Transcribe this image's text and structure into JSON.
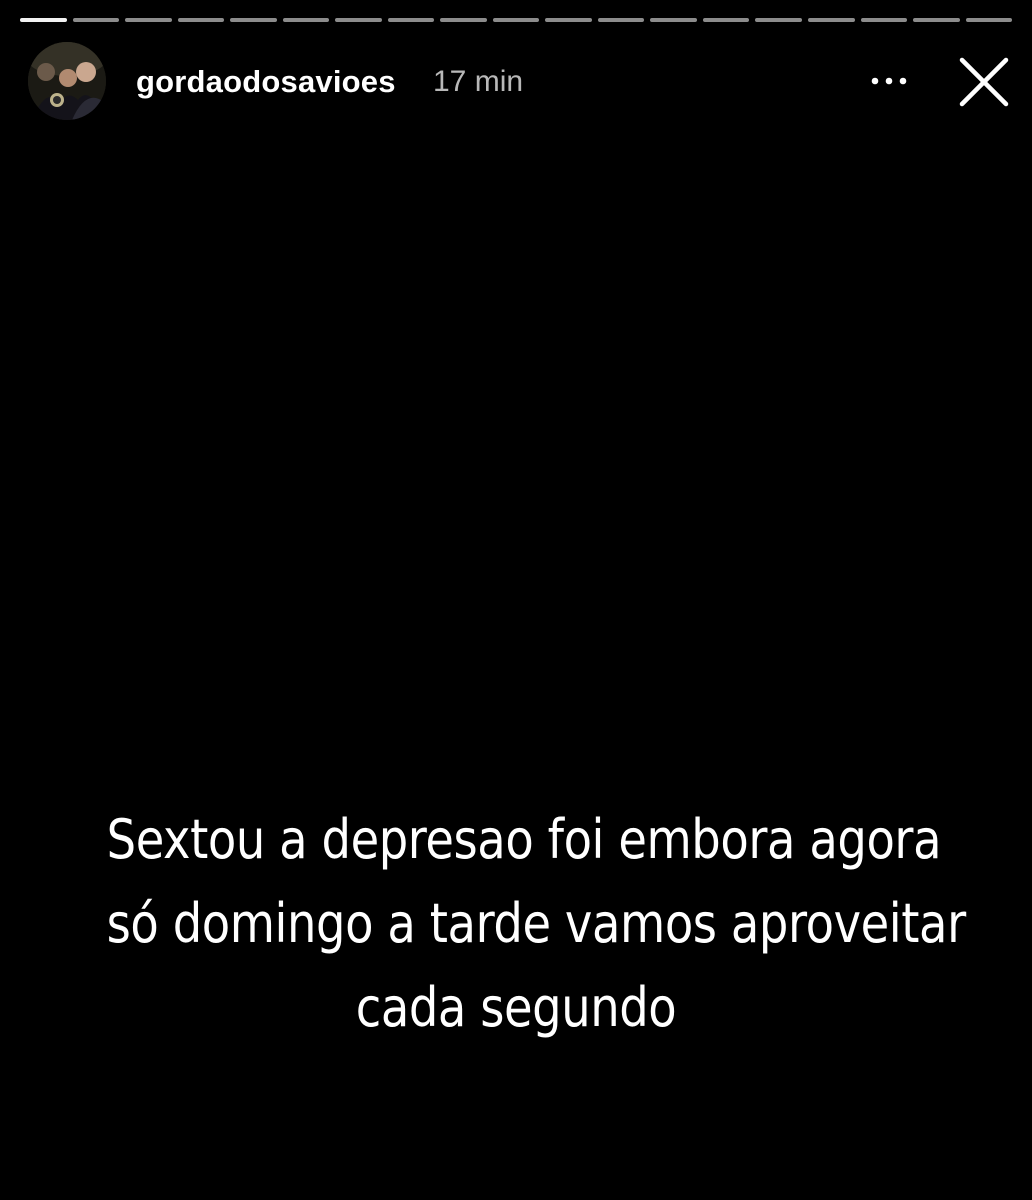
{
  "progress": {
    "segments": 19,
    "active_index": 0
  },
  "header": {
    "username": "gordaodosavioes",
    "time_ago": "17 min",
    "more_icon": "more-horizontal-icon",
    "close_icon": "close-icon"
  },
  "story": {
    "lines": [
      "Sextou a depresao foi embora agora",
      "só domingo a tarde vamos aproveitar",
      "cada segundo"
    ]
  },
  "colors": {
    "background": "#000000",
    "text": "#ffffff",
    "progress_inactive": "rgba(255,255,255,0.55)"
  }
}
